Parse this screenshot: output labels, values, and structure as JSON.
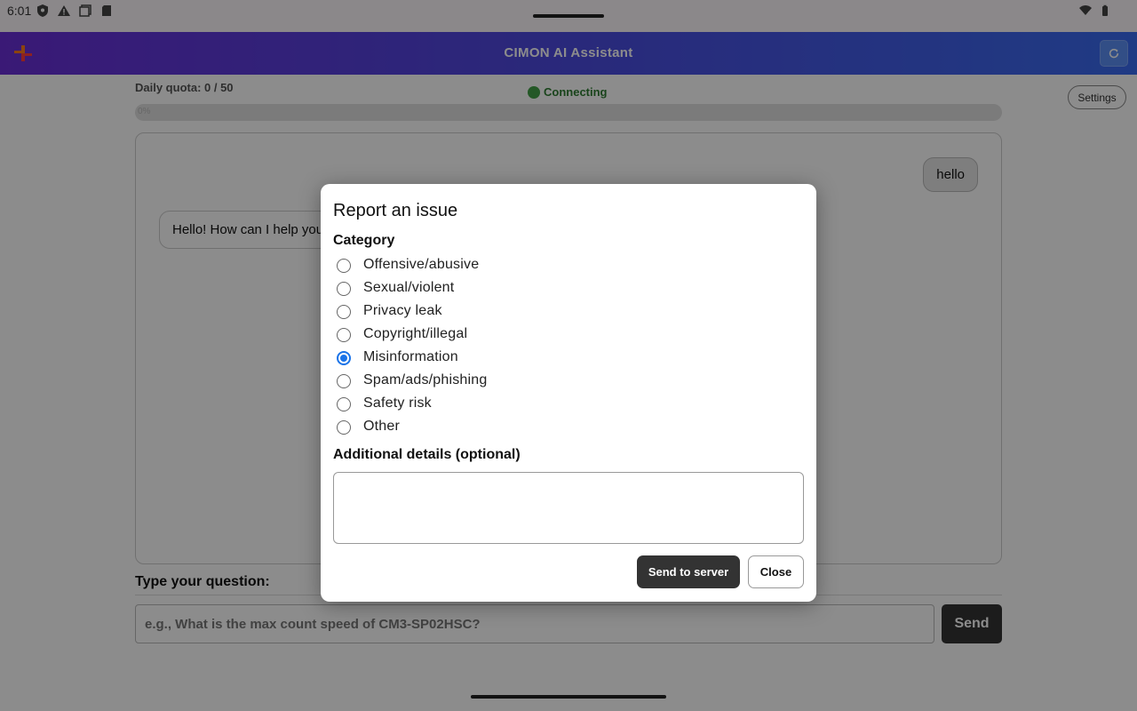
{
  "status_bar": {
    "time": "6:01",
    "left_icons": [
      "shield-icon",
      "warning-icon",
      "copy-icon",
      "sd-card-icon"
    ],
    "right_icons": [
      "wifi-icon",
      "battery-icon"
    ]
  },
  "app_bar": {
    "title": "CIMON AI Assistant",
    "logo_icon": "cimon-logo-icon",
    "refresh_icon": "refresh-icon",
    "accent_colors": [
      "#6a2fd8",
      "#3a6cf0"
    ]
  },
  "header": {
    "quota_text": "Daily quota: 0 / 50",
    "connection_text": "Connecting",
    "settings_label": "Settings",
    "progress_label": "0%",
    "progress_value": 0
  },
  "chat": {
    "user_message": "hello",
    "bot_message": "Hello! How can I help you"
  },
  "composer": {
    "label": "Type your question:",
    "placeholder": "e.g., What is the max count speed of CM3-SP02HSC?",
    "send_label": "Send"
  },
  "dialog": {
    "title": "Report an issue",
    "category_label": "Category",
    "categories": [
      {
        "label": "Offensive/abusive",
        "checked": false
      },
      {
        "label": "Sexual/violent",
        "checked": false
      },
      {
        "label": "Privacy leak",
        "checked": false
      },
      {
        "label": "Copyright/illegal",
        "checked": false
      },
      {
        "label": "Misinformation",
        "checked": true
      },
      {
        "label": "Spam/ads/phishing",
        "checked": false
      },
      {
        "label": "Safety risk",
        "checked": false
      },
      {
        "label": "Other",
        "checked": false
      }
    ],
    "details_label": "Additional details (optional)",
    "details_value": "",
    "send_to_server_label": "Send to server",
    "close_label": "Close",
    "radio_accent_color": "#1a73e8"
  }
}
